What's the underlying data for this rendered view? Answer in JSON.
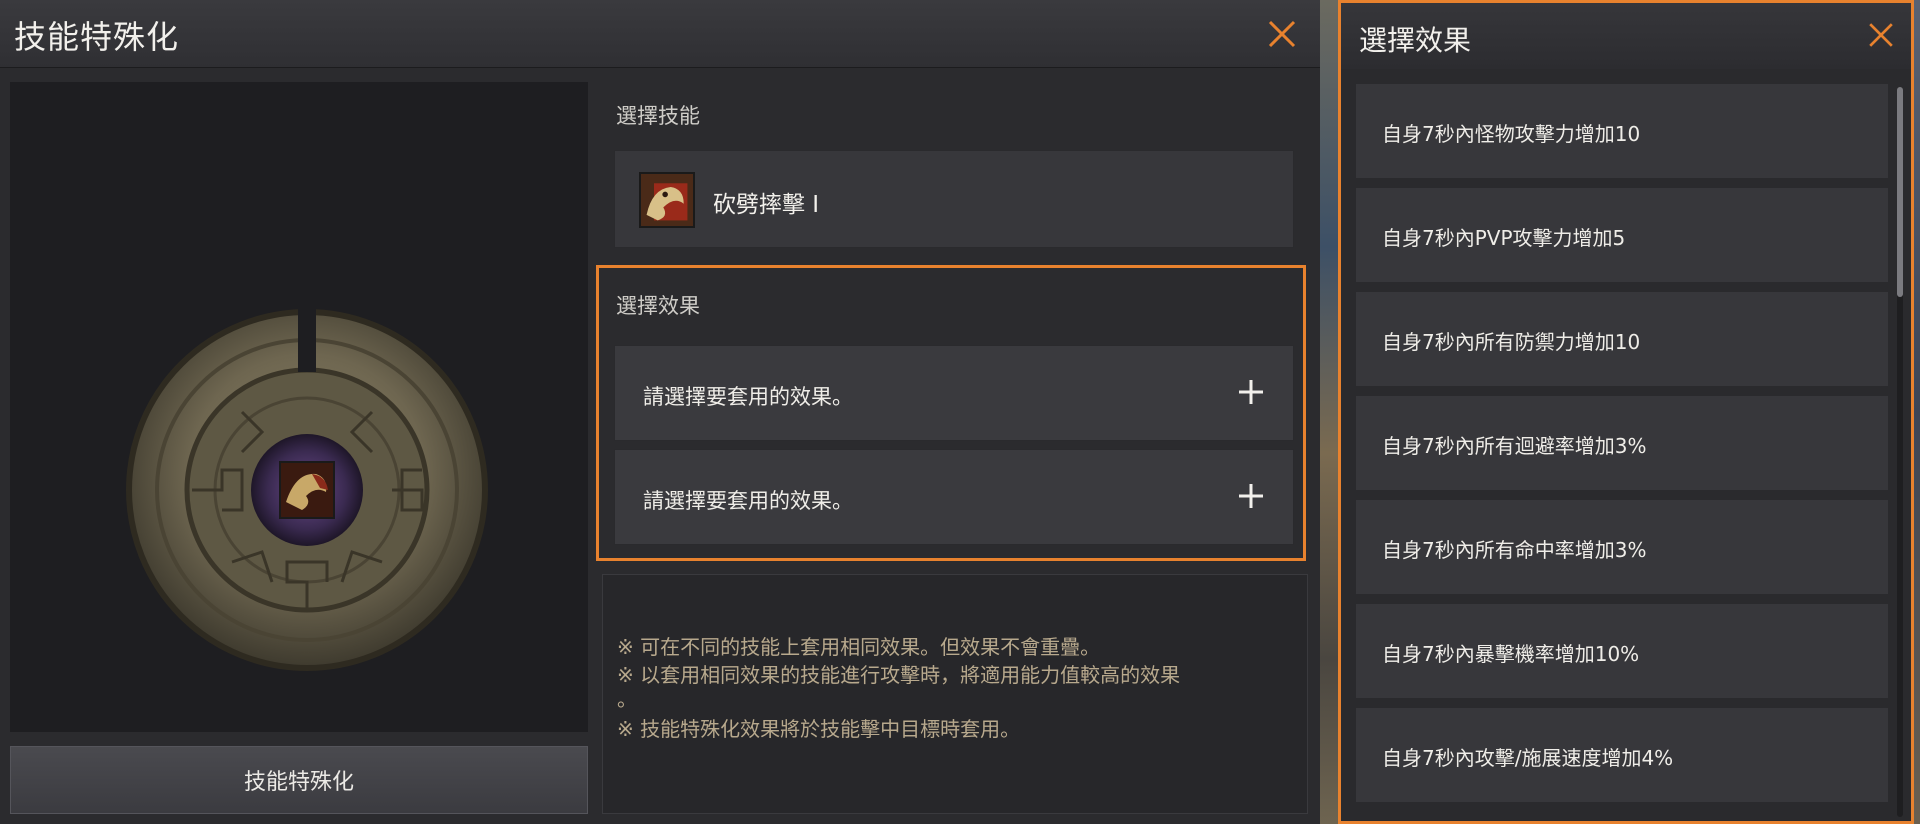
{
  "left_panel": {
    "title": "技能特殊化",
    "specialize_button": "技能特殊化",
    "select_skill_label": "選擇技能",
    "skill": {
      "name": "砍劈摔擊 I",
      "icon": "skill-icon"
    },
    "select_effect_label": "選擇效果",
    "effect_slots": [
      {
        "text": "請選擇要套用的效果。",
        "icon": "plus-icon"
      },
      {
        "text": "請選擇要套用的效果。",
        "icon": "plus-icon"
      }
    ],
    "notes": [
      "※ 可在不同的技能上套用相同效果。但效果不會重疊。",
      "※ 以套用相同效果的技能進行攻擊時，將適用能力值較高的效果",
      "。",
      "※ 技能特殊化效果將於技能擊中目標時套用。"
    ]
  },
  "right_panel": {
    "title": "選擇效果",
    "options": [
      "自身7秒內怪物攻擊力增加10",
      "自身7秒內PVP攻擊力增加5",
      "自身7秒內所有防禦力增加10",
      "自身7秒內所有迴避率增加3%",
      "自身7秒內所有命中率增加3%",
      "自身7秒內暴擊機率增加10%",
      "自身7秒內攻擊/施展速度增加4%"
    ]
  },
  "colors": {
    "accent_orange": "#e8822e",
    "panel_bg": "#2b2b2e",
    "note_text": "#b8a98d"
  }
}
